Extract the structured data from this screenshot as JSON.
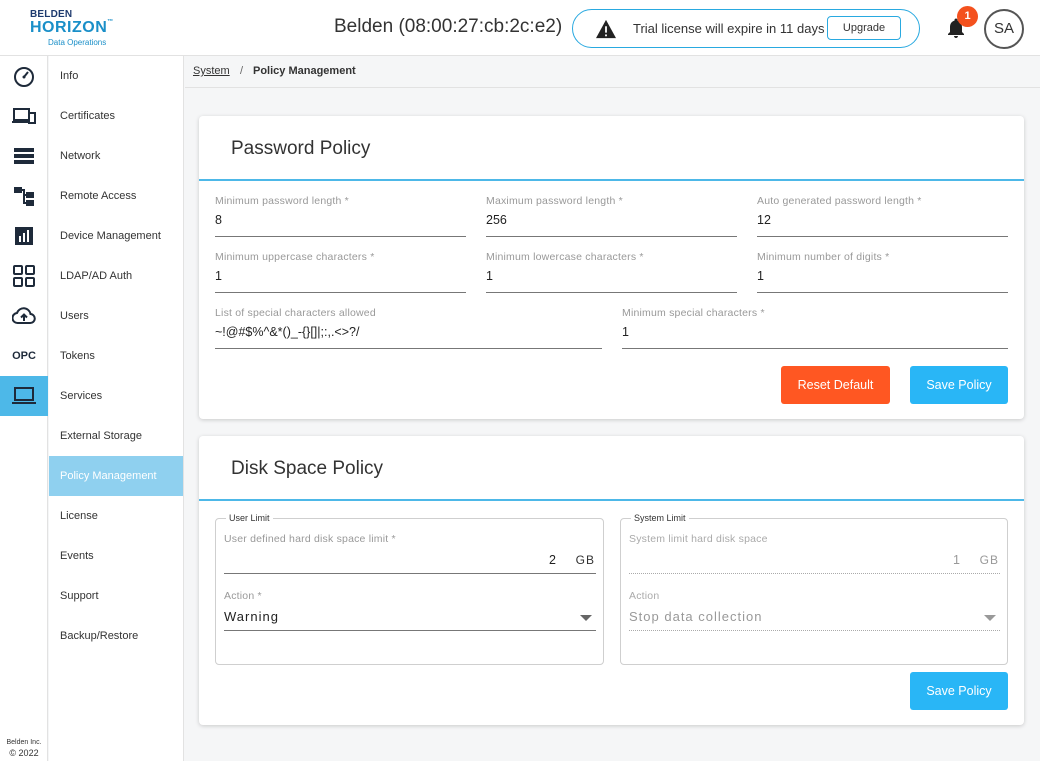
{
  "header": {
    "logo": {
      "line1": "BELDEN",
      "line2": "HORIZON",
      "trademark": "™",
      "line3": "Data Operations"
    },
    "device_title": "Belden (08:00:27:cb:2c:e2)",
    "trial_message": "Trial license will expire in 11 days",
    "upgrade_label": "Upgrade",
    "notification_count": "1",
    "avatar_initials": "SA"
  },
  "rail": {
    "items": [
      {
        "icon": "dashboard-icon"
      },
      {
        "icon": "devices-icon"
      },
      {
        "icon": "storage-list-icon"
      },
      {
        "icon": "network-topology-icon"
      },
      {
        "icon": "analytics-icon"
      },
      {
        "icon": "apps-grid-icon"
      },
      {
        "icon": "cloud-upload-icon"
      },
      {
        "icon": "opc-icon",
        "label": "OPC"
      },
      {
        "icon": "system-laptop-icon",
        "active": true
      }
    ],
    "footer": {
      "company": "Belden Inc.",
      "copyright": "© 2022"
    }
  },
  "menu": {
    "items": [
      {
        "label": "Info"
      },
      {
        "label": "Certificates"
      },
      {
        "label": "Network"
      },
      {
        "label": "Remote Access"
      },
      {
        "label": "Device Management"
      },
      {
        "label": "LDAP/AD Auth"
      },
      {
        "label": "Users"
      },
      {
        "label": "Tokens"
      },
      {
        "label": "Services"
      },
      {
        "label": "External Storage"
      },
      {
        "label": "Policy Management",
        "active": true
      },
      {
        "label": "License"
      },
      {
        "label": "Events"
      },
      {
        "label": "Support"
      },
      {
        "label": "Backup/Restore"
      }
    ]
  },
  "breadcrumb": {
    "parent": "System",
    "separator": "/",
    "current": "Policy Management"
  },
  "password_policy": {
    "title": "Password Policy",
    "fields": {
      "min_length": {
        "label": "Minimum password length *",
        "value": "8"
      },
      "max_length": {
        "label": "Maximum password length *",
        "value": "256"
      },
      "auto_length": {
        "label": "Auto generated password length *",
        "value": "12"
      },
      "min_upper": {
        "label": "Minimum uppercase characters *",
        "value": "1"
      },
      "min_lower": {
        "label": "Minimum lowercase characters *",
        "value": "1"
      },
      "min_digits": {
        "label": "Minimum number of digits *",
        "value": "1"
      },
      "special_list": {
        "label": "List of special characters allowed",
        "value": "~!@#$%^&*()_-{}[]|;:,.<>?/"
      },
      "min_special": {
        "label": "Minimum special characters *",
        "value": "1"
      }
    },
    "reset_label": "Reset Default",
    "save_label": "Save Policy"
  },
  "disk_policy": {
    "title": "Disk Space Policy",
    "user_limit": {
      "legend": "User Limit",
      "field_label": "User defined hard disk space limit *",
      "value": "2",
      "unit": "GB",
      "action_label": "Action *",
      "action_value": "Warning"
    },
    "system_limit": {
      "legend": "System Limit",
      "field_label": "System limit hard disk space",
      "value": "1",
      "unit": "GB",
      "action_label": "Action",
      "action_value": "Stop data collection"
    },
    "save_label": "Save Policy"
  },
  "colors": {
    "accent": "#29b6f6",
    "reset": "#ff5722",
    "active_nav": "#4db8e8",
    "badge": "#f4511e"
  }
}
